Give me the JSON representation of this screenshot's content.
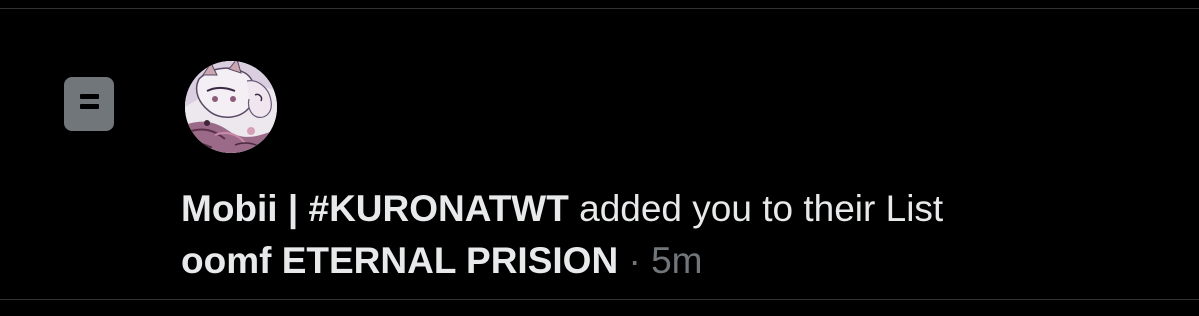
{
  "notification": {
    "icon": "list-icon",
    "avatar_icon": "anime-avatar",
    "user_display_name": "Mobii | #KURONATWT",
    "action_text": " added you to their List",
    "list_name": "oomf ETERNAL PRISION",
    "separator": " · ",
    "timestamp": "5m"
  },
  "colors": {
    "background": "#000000",
    "text_primary": "#e7e9ea",
    "text_secondary": "#71767b",
    "icon_background": "#71767b",
    "divider": "#2f3336"
  }
}
